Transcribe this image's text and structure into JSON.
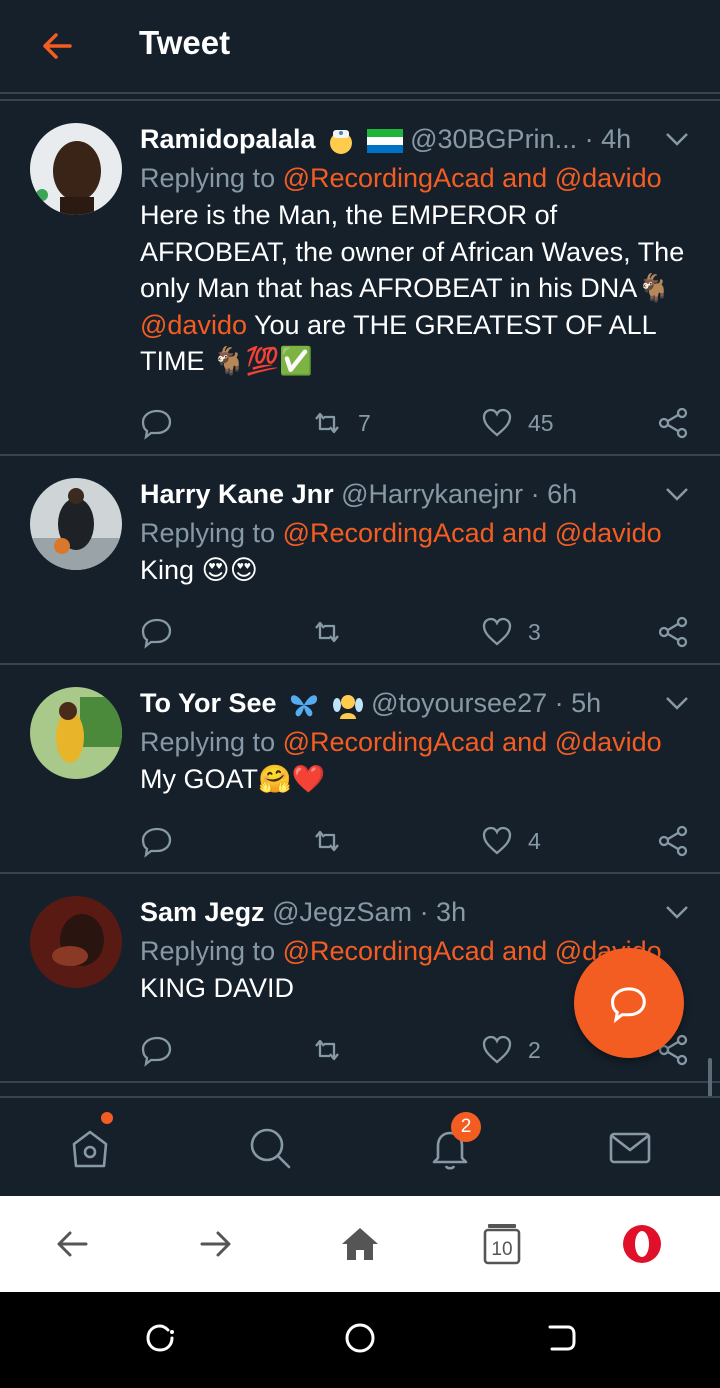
{
  "header": {
    "title": "Tweet",
    "back_icon": "arrow-left-icon"
  },
  "colors": {
    "background": "#15202b",
    "accent": "#f45d22",
    "secondary_text": "#8899a6",
    "divider": "#38444d"
  },
  "tweets": [
    {
      "name": "Ramidopalala",
      "handle": "@30BGPrin...",
      "time": "· 4h",
      "replying_prefix": "Replying to ",
      "mention1": "@RecordingAcad",
      "and": " and ",
      "mention2": "@davido",
      "text": "Here is the Man, the EMPEROR of AFROBEAT, the owner of African Waves, The only Man that has AFROBEAT in his DNA🐐 ",
      "text_mention": "@davido",
      "text_tail": " You are THE GREATEST OF ALL TIME 🐐💯✅",
      "retweets": "7",
      "likes": "45"
    },
    {
      "name": "Harry Kane Jnr",
      "handle": "@Harrykanejnr",
      "time": "· 6h",
      "replying_prefix": "Replying to ",
      "mention1": "@RecordingAcad",
      "and": " and ",
      "mention2": "@davido",
      "text": "King 😍😍",
      "retweets": "",
      "likes": "3"
    },
    {
      "name": "To Yor See",
      "handle": "@toyoursee27",
      "time": "· 5h",
      "replying_prefix": "Replying to ",
      "mention1": "@RecordingAcad",
      "and": " and ",
      "mention2": "@davido",
      "text": "My GOAT🤗❤️",
      "retweets": "",
      "likes": "4"
    },
    {
      "name": "Sam Jegz",
      "handle": "@JegzSam",
      "time": "· 3h",
      "replying_prefix": "Replying to ",
      "mention1": "@RecordingAcad",
      "and": " and ",
      "mention2": "@davido",
      "text": "KING DAVID",
      "retweets": "",
      "likes": "2"
    }
  ],
  "tabbar": {
    "notifications_badge": "2"
  },
  "browser": {
    "tab_count": "10"
  }
}
